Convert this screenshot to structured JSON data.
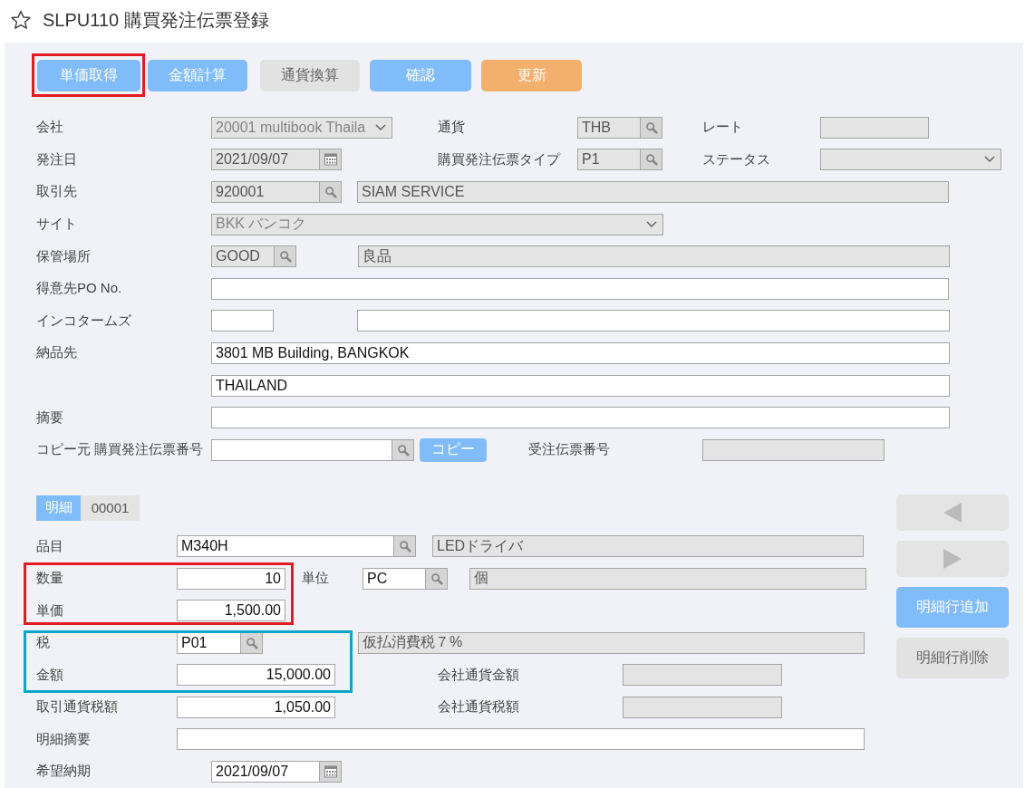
{
  "title": "SLPU110 購買発注伝票登録",
  "toolbar": [
    {
      "label": "単価取得",
      "kind": "primary"
    },
    {
      "label": "金額計算",
      "kind": "primary"
    },
    {
      "label": "通貨換算",
      "kind": "disabled"
    },
    {
      "label": "確認",
      "kind": "primary"
    },
    {
      "label": "更新",
      "kind": "update"
    }
  ],
  "annotation_frames": [
    {
      "color": "#e31b23"
    },
    {
      "color": "#e31b23"
    },
    {
      "color": "#0ba5c9"
    }
  ],
  "header": {
    "company": {
      "label": "会社",
      "value": "20001 multibook Thaila"
    },
    "currency": {
      "label": "通貨",
      "value": "THB"
    },
    "rate": {
      "label": "レート"
    },
    "order_date": {
      "label": "発注日",
      "value": "2021/09/07"
    },
    "po_type": {
      "label": "購買発注伝票タイプ",
      "value": "P1"
    },
    "status": {
      "label": "ステータス"
    },
    "supplier": {
      "label": "取引先",
      "value": "920001",
      "name": "SIAM SERVICE"
    },
    "site": {
      "label": "サイト",
      "value": "BKK バンコク"
    },
    "storage": {
      "label": "保管場所",
      "value": "GOOD",
      "name": "良品"
    },
    "customer_po": {
      "label": "得意先PO No."
    },
    "incoterms": {
      "label": "インコタームズ"
    },
    "delivery": {
      "label": "納品先",
      "line1": "3801 MB Building, BANGKOK",
      "line2": "THAILAND"
    },
    "memo": {
      "label": "摘要"
    },
    "copy_source": {
      "label": "コピー元 購買発注伝票番号",
      "button": "コピー"
    },
    "sales_order": {
      "label": "受注伝票番号"
    }
  },
  "detail": {
    "tab": {
      "label": "明細",
      "number": "00001"
    },
    "side_buttons": [
      {
        "label": "明細行追加",
        "kind": "primary"
      },
      {
        "label": "明細行削除",
        "kind": "disabled"
      }
    ],
    "item": {
      "label": "品目",
      "value": "M340H",
      "name": "LEDドライバ"
    },
    "quantity": {
      "label": "数量",
      "value": "10"
    },
    "unit": {
      "label": "単位",
      "value": "PC",
      "name": "個"
    },
    "unit_price": {
      "label": "単価",
      "value": "1,500.00"
    },
    "tax": {
      "label": "税",
      "value": "P01",
      "name": "仮払消費税７%"
    },
    "amount": {
      "label": "金額",
      "value": "15,000.00"
    },
    "company_amount": {
      "label": "会社通貨金額"
    },
    "tax_amount": {
      "label": "取引通貨税額",
      "value": "1,050.00"
    },
    "company_tax": {
      "label": "会社通貨税額"
    },
    "line_memo": {
      "label": "明細摘要"
    },
    "due_date": {
      "label": "希望納期",
      "value": "2021/09/07"
    }
  }
}
